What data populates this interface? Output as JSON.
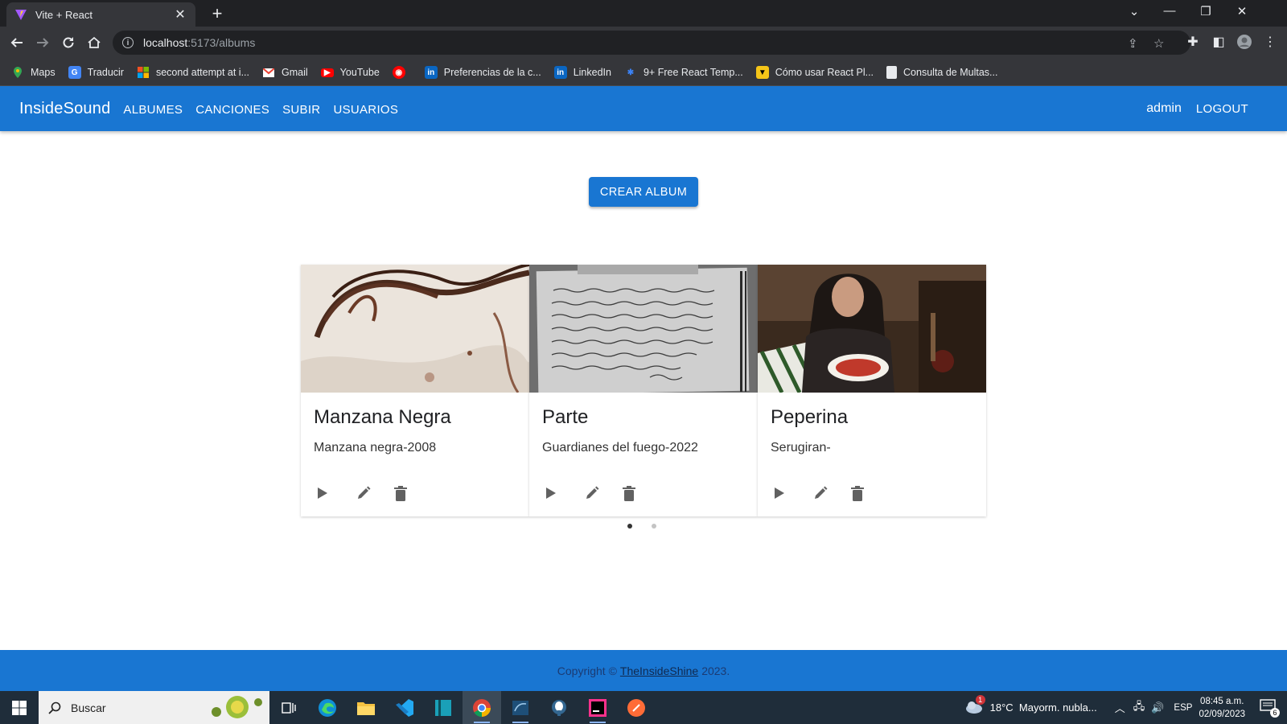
{
  "browser": {
    "tab_title": "Vite + React",
    "url_host": "localhost",
    "url_path": ":5173/albums",
    "bookmarks": [
      {
        "label": "Maps",
        "icon": "maps-icon",
        "color": "#34a853"
      },
      {
        "label": "Traducir",
        "icon": "translate-icon",
        "color": "#4285f4"
      },
      {
        "label": "second attempt at i...",
        "icon": "microsoft-icon",
        "color": "#f25022"
      },
      {
        "label": "Gmail",
        "icon": "gmail-icon",
        "color": "#ea4335"
      },
      {
        "label": "YouTube",
        "icon": "youtube-icon",
        "color": "#ff0000"
      },
      {
        "label": "",
        "icon": "youtube-music-icon",
        "color": "#ff0000"
      },
      {
        "label": "Preferencias de la c...",
        "icon": "linkedin-icon",
        "color": "#0a66c2"
      },
      {
        "label": "LinkedIn",
        "icon": "linkedin-icon",
        "color": "#0a66c2"
      },
      {
        "label": "9+ Free React Temp...",
        "icon": "react-template-icon",
        "color": "#3b82f6"
      },
      {
        "label": "Cómo usar React Pl...",
        "icon": "batman-icon",
        "color": "#f5c518"
      },
      {
        "label": "Consulta de Multas...",
        "icon": "document-icon",
        "color": "#e8eaed"
      }
    ]
  },
  "app": {
    "brand": "InsideSound",
    "nav": [
      "ALBUMES",
      "CANCIONES",
      "SUBIR",
      "USUARIOS"
    ],
    "user": "admin",
    "logout": "LOGOUT",
    "create_button": "CREAR ALBUM",
    "accent_color": "#1976d2",
    "albums": [
      {
        "title": "Manzana Negra",
        "subtitle": "Manzana negra-2008",
        "image": "hair-photo"
      },
      {
        "title": "Parte",
        "subtitle": "Guardianes del fuego-2022",
        "image": "handwritten-notebook-photo"
      },
      {
        "title": "Peperina",
        "subtitle": "Serugiran-",
        "image": "girl-with-plate-photo"
      }
    ],
    "carousel": {
      "pages": 2,
      "active": 0
    },
    "footer": {
      "prefix": "Copyright ©",
      "link": "TheInsideShine",
      "suffix": "2023."
    }
  },
  "taskbar": {
    "search_placeholder": "Buscar",
    "weather": "18°C  Mayorm. nubla...",
    "weather_badge": "1",
    "language": "ESP",
    "time": "08:45 a.m.",
    "date": "02/09/2023",
    "notifications": "6"
  }
}
